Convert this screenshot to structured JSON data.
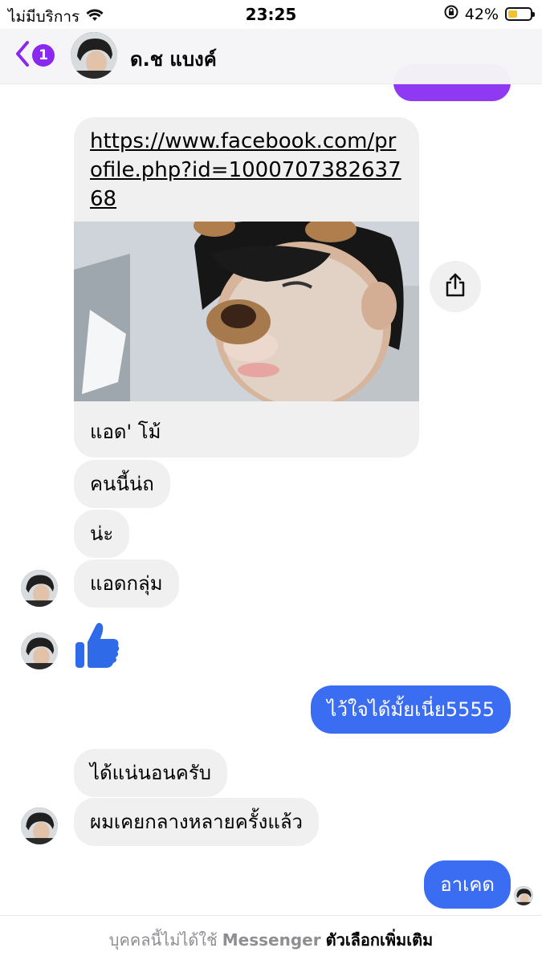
{
  "status_bar": {
    "carrier": "ไม่มีบริการ",
    "time": "23:25",
    "battery": "42%",
    "battery_level": 0.42
  },
  "header": {
    "unread_count": "1",
    "contact_name": "ด.ช แบงค์"
  },
  "messages": {
    "link_url": "https://www.facebook.com/profile.php?id=100070738263768",
    "link_caption": "แอด' โม้",
    "m1": "คนนี้น่ถ",
    "m2": "น่ะ",
    "m3": "แอดกลุ่ม",
    "sticker": "thumbs-up",
    "out1": "ไว้ใจได้มั้ยเนี่ย5555",
    "m4": "ได้แน่นอนครับ",
    "m5": "ผมเคยกลางหลายครั้งแล้ว",
    "out2": "อาเคด"
  },
  "footer": {
    "notice": "บุคคลนี้ไม่ได้ใช้",
    "brand": "Messenger",
    "more_options": "ตัวเลือกเพิ่มเติม"
  },
  "colors": {
    "accent_purple": "#8b28f0",
    "outgoing_blue": "#3b6df2",
    "incoming_gray": "#f0f0f0",
    "like_blue": "#2f6ae8"
  }
}
